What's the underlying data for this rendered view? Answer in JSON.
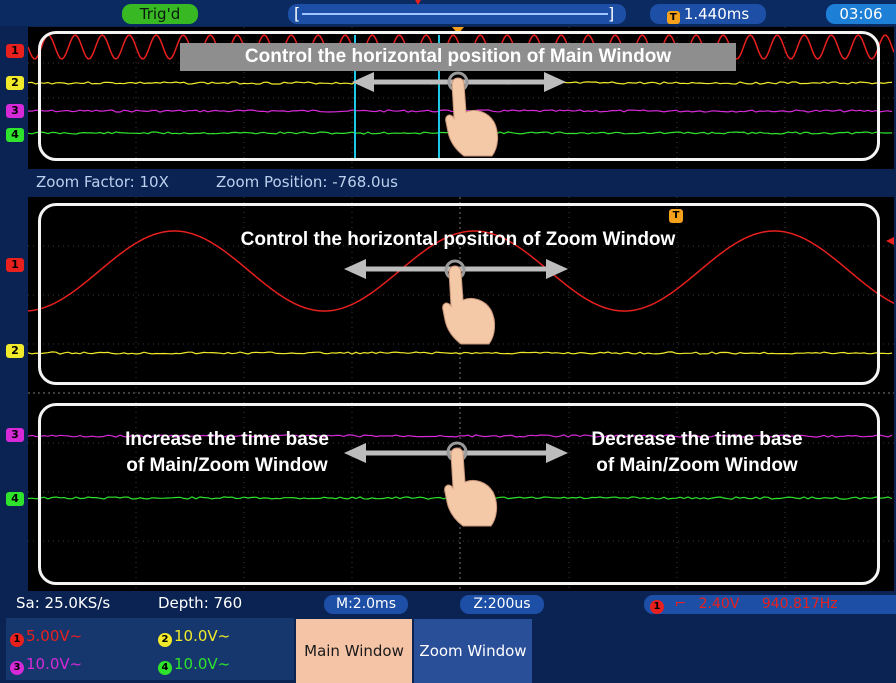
{
  "topbar": {
    "trigger_status": "Trig'd",
    "timebar_left": "[",
    "timebar_right": "]",
    "trigger_time": "1.440ms",
    "trigger_badge": "T",
    "clock": "03:06"
  },
  "main_window": {
    "callout": "Control the horizontal position of Main Window"
  },
  "zoom_info": {
    "factor": "Zoom Factor: 10X",
    "position": "Zoom Position: -768.0us"
  },
  "zoom_window": {
    "callout_position": "Control the horizontal position of Zoom Window",
    "callout_increase_line1": "Increase the time base",
    "callout_increase_line2": "of Main/Zoom Window",
    "callout_decrease_line1": "Decrease the time base",
    "callout_decrease_line2": "of Main/Zoom Window",
    "trigger_badge": "T"
  },
  "channel_markers": [
    "1",
    "2",
    "3",
    "4"
  ],
  "colors": {
    "ch1": "#e8201e",
    "ch2": "#f1ea2a",
    "ch3": "#d62ad8",
    "ch4": "#2fe32d",
    "accent": "#1d4fa6"
  },
  "status": {
    "sample_rate": "Sa: 25.0KS/s",
    "depth": "Depth: 760",
    "main_timebase": "M:2.0ms",
    "zoom_timebase": "Z:200us",
    "trigger_channel": "1",
    "trigger_level": "2.40V",
    "frequency": "940.817Hz"
  },
  "channels": [
    {
      "num": "1",
      "scale": "5.00V",
      "coupling": "~"
    },
    {
      "num": "2",
      "scale": "10.0V",
      "coupling": "~"
    },
    {
      "num": "3",
      "scale": "10.0V",
      "coupling": "~"
    },
    {
      "num": "4",
      "scale": "10.0V",
      "coupling": "~"
    }
  ],
  "buttons": {
    "main_window": "Main Window",
    "zoom_window": "Zoom Window"
  }
}
